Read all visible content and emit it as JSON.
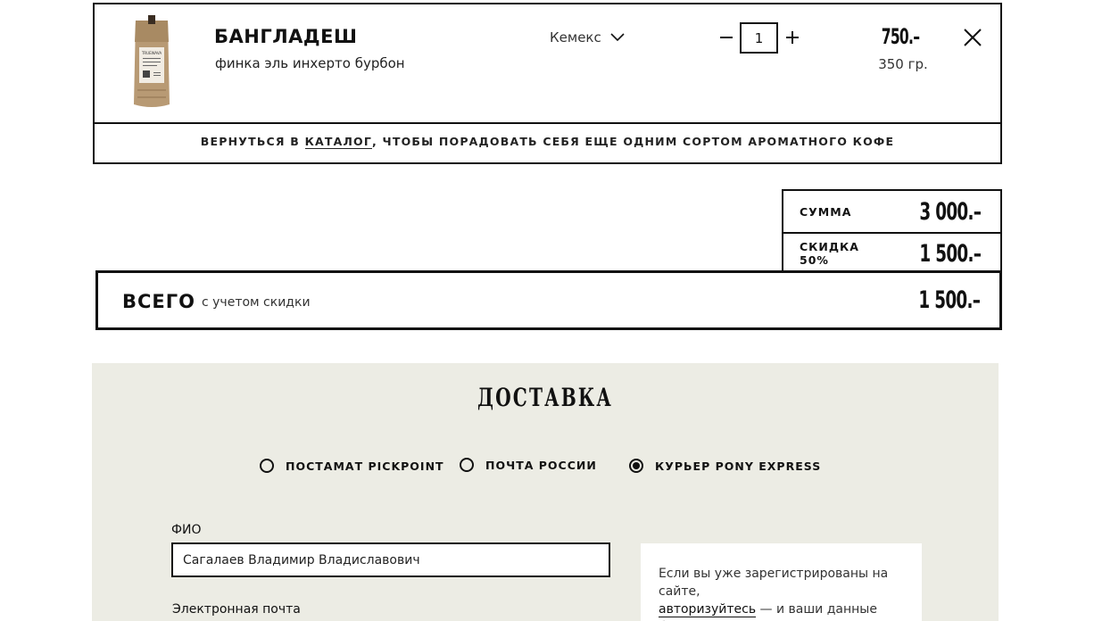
{
  "cart": {
    "item": {
      "name": "БАНГЛАДЕШ",
      "description": "финка эль инхерто бурбон",
      "brew_method": "Кемекс",
      "quantity": "1",
      "price": "750.–",
      "weight": "350 гр.",
      "package_label": "TRUEWAVA"
    },
    "back_prefix": "ВЕРНУТЬСЯ В ",
    "back_link": "КАТАЛОГ",
    "back_suffix": ", ЧТОБЫ ПОРАДОВАТЬ СЕБЯ ЕЩЕ ОДНИМ СОРТОМ АРОМАТНОГО КОФЕ"
  },
  "totals": {
    "sum_label": "СУММА",
    "sum_value": "3 000.–",
    "discount_label": "СКИДКА 50%",
    "discount_value": "1 500.–",
    "total_label": "ВСЕГО",
    "total_note": "с учетом скидки",
    "total_value": "1 500.–"
  },
  "delivery": {
    "title": "ДОСТАВКА",
    "options": [
      {
        "label": "ПОСТАМАТ PICKPOINT",
        "selected": false
      },
      {
        "label": "ПОЧТА РОССИИ",
        "selected": false
      },
      {
        "label": "КУРЬЕР PONY EXPRESS",
        "selected": true
      }
    ],
    "name_label": "ФИО",
    "name_value": "Сагалаев Владимир Владиславович",
    "email_label": "Электронная почта",
    "login_text_1": "Если вы уже зарегистрированы на сайте,",
    "login_link": "авторизуйтесь",
    "login_text_2": " — и ваши данные будут автоматически подставлены."
  },
  "colors": {
    "delivery_bg": "#ecece4",
    "border": "#111111"
  }
}
